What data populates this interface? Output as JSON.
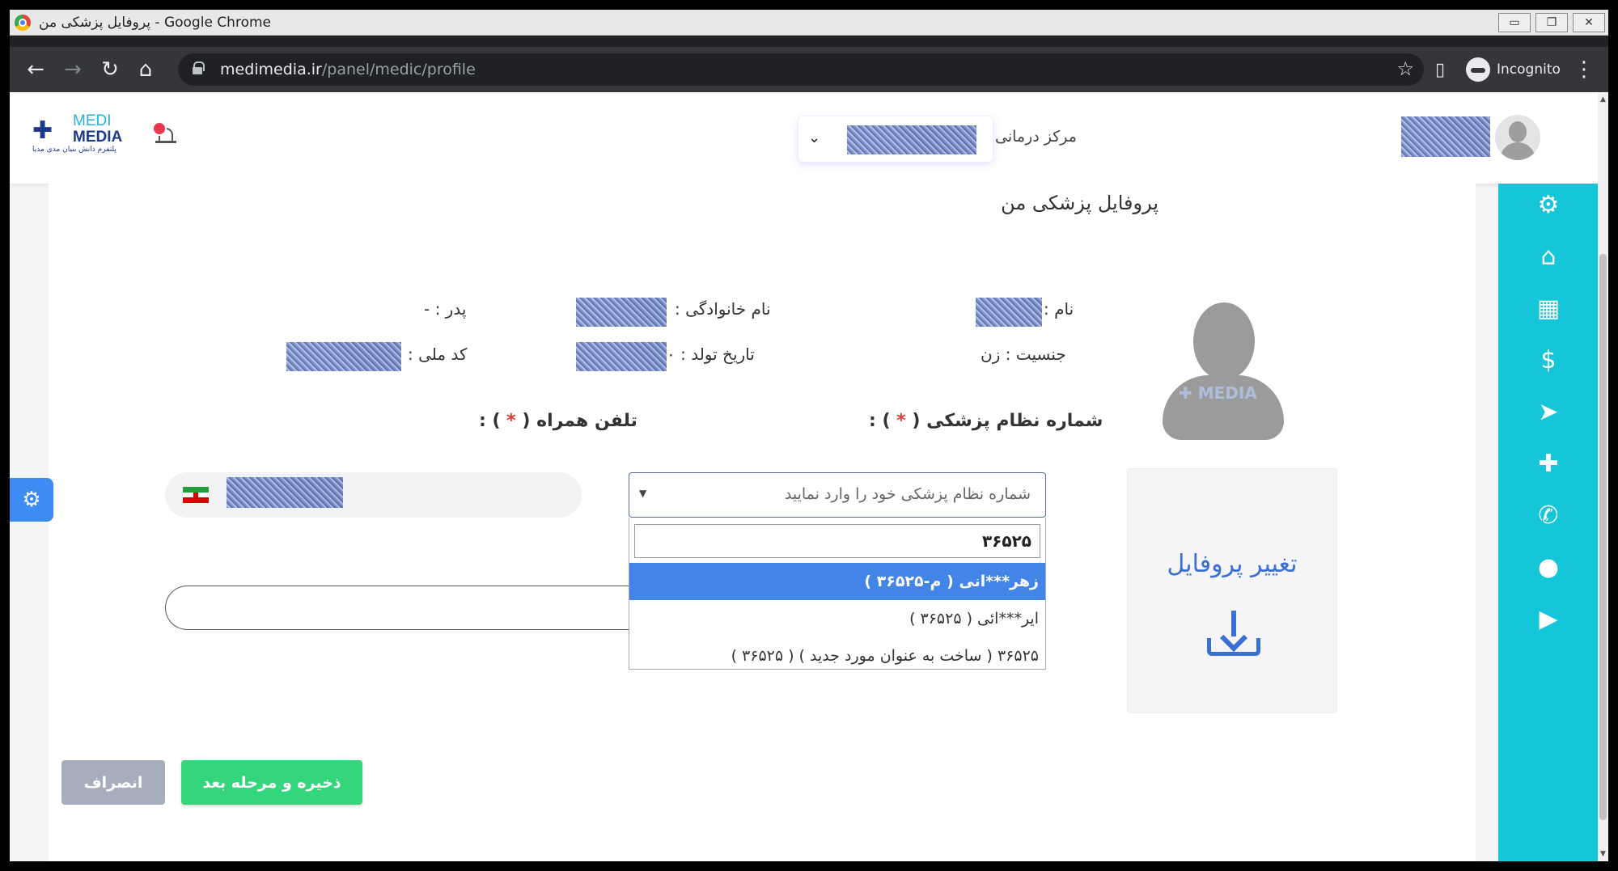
{
  "window": {
    "title": "پروفایل پزشکی من - Google Chrome",
    "buttons": {
      "minimize": "▭",
      "restore": "❐",
      "close": "✕"
    }
  },
  "browser": {
    "url_host": "medimedia.ir",
    "url_path": "/panel/medic/profile",
    "incognito_label": "Incognito"
  },
  "header": {
    "logo_medi": "MEDI",
    "logo_media": "MEDIA",
    "logo_tagline": "پلتفرم دانش بنیان مدی مدیا",
    "center_label": "مرکز درمانی",
    "icons": [
      "bell-icon",
      "chevron-down-icon",
      "user-avatar-icon"
    ]
  },
  "page": {
    "title": "پروفایل پزشکی من"
  },
  "profile_info": {
    "first_name_label": "نام :",
    "last_name_label": "نام خانوادگی :",
    "father_label": "پدر : -",
    "gender_label": "جنسیت : زن",
    "birth_label": "تاریخ تولد : ۰",
    "national_id_label": "کد ملی :"
  },
  "form": {
    "medical_number_label": "شماره نظام پزشکی",
    "mobile_label": "تلفن همراه",
    "required_open": "( ",
    "required_star": "*",
    "required_close": " ) :",
    "medical_number_placeholder": "شماره نظام پزشکی خود را وارد نمایید",
    "dropdown_search_value": "۳۶۵۲۵",
    "dropdown_options": [
      "زهر***انی ( م-۳۶۵۲۵ )",
      "ایر***ائی ( ۳۶۵۲۵ )",
      "۳۶۵۲۵ ( ساخت به عنوان مورد جدید ) ( ۳۶۵۲۵ )"
    ]
  },
  "upload": {
    "label": "تغییر پروفایل",
    "icon": "download-icon"
  },
  "buttons": {
    "save": "ذخیره و مرحله بعد",
    "cancel": "انصراف"
  },
  "sidebar": {
    "icons": [
      "gear-icon",
      "clinic-icon",
      "building-user-icon",
      "hand-money-icon",
      "send-icon",
      "file-plus-icon",
      "phone-icon",
      "user-icon",
      "video-icon"
    ]
  },
  "colors": {
    "sidebar": "#15c5d8",
    "save_button": "#34d67b",
    "cancel_button": "#a6aebd",
    "selected_option": "#4285e6",
    "upload_accent": "#3b6fd6"
  }
}
